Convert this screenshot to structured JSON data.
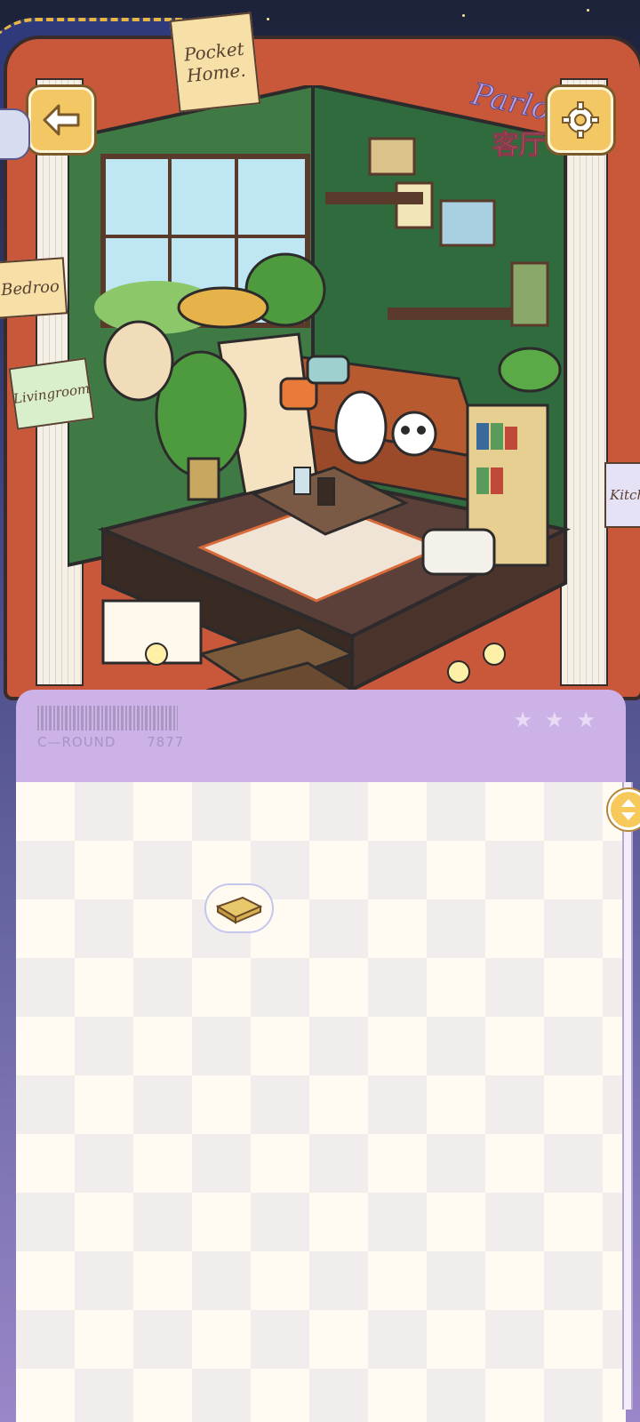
{
  "header": {
    "back_icon": "arrow-left-icon",
    "settings_icon": "gear-icon"
  },
  "logo": {
    "line1": "Parlor",
    "line2": "客厅"
  },
  "signs": {
    "pocket_home_1": "Pocket",
    "pocket_home_2": "Home.",
    "bedroom": "Bedroo",
    "living": "Livingroom",
    "kitchen": "Kitch"
  },
  "panel": {
    "round_label": "C—ROUND",
    "round_number": "7877"
  },
  "inventory": {
    "items": [
      {
        "name": "wooden-brick-item"
      }
    ]
  },
  "colors": {
    "accent": "#f3c763",
    "panel": "#cdb2e8",
    "book": "#c9583a",
    "wall": "#3f7a45"
  }
}
